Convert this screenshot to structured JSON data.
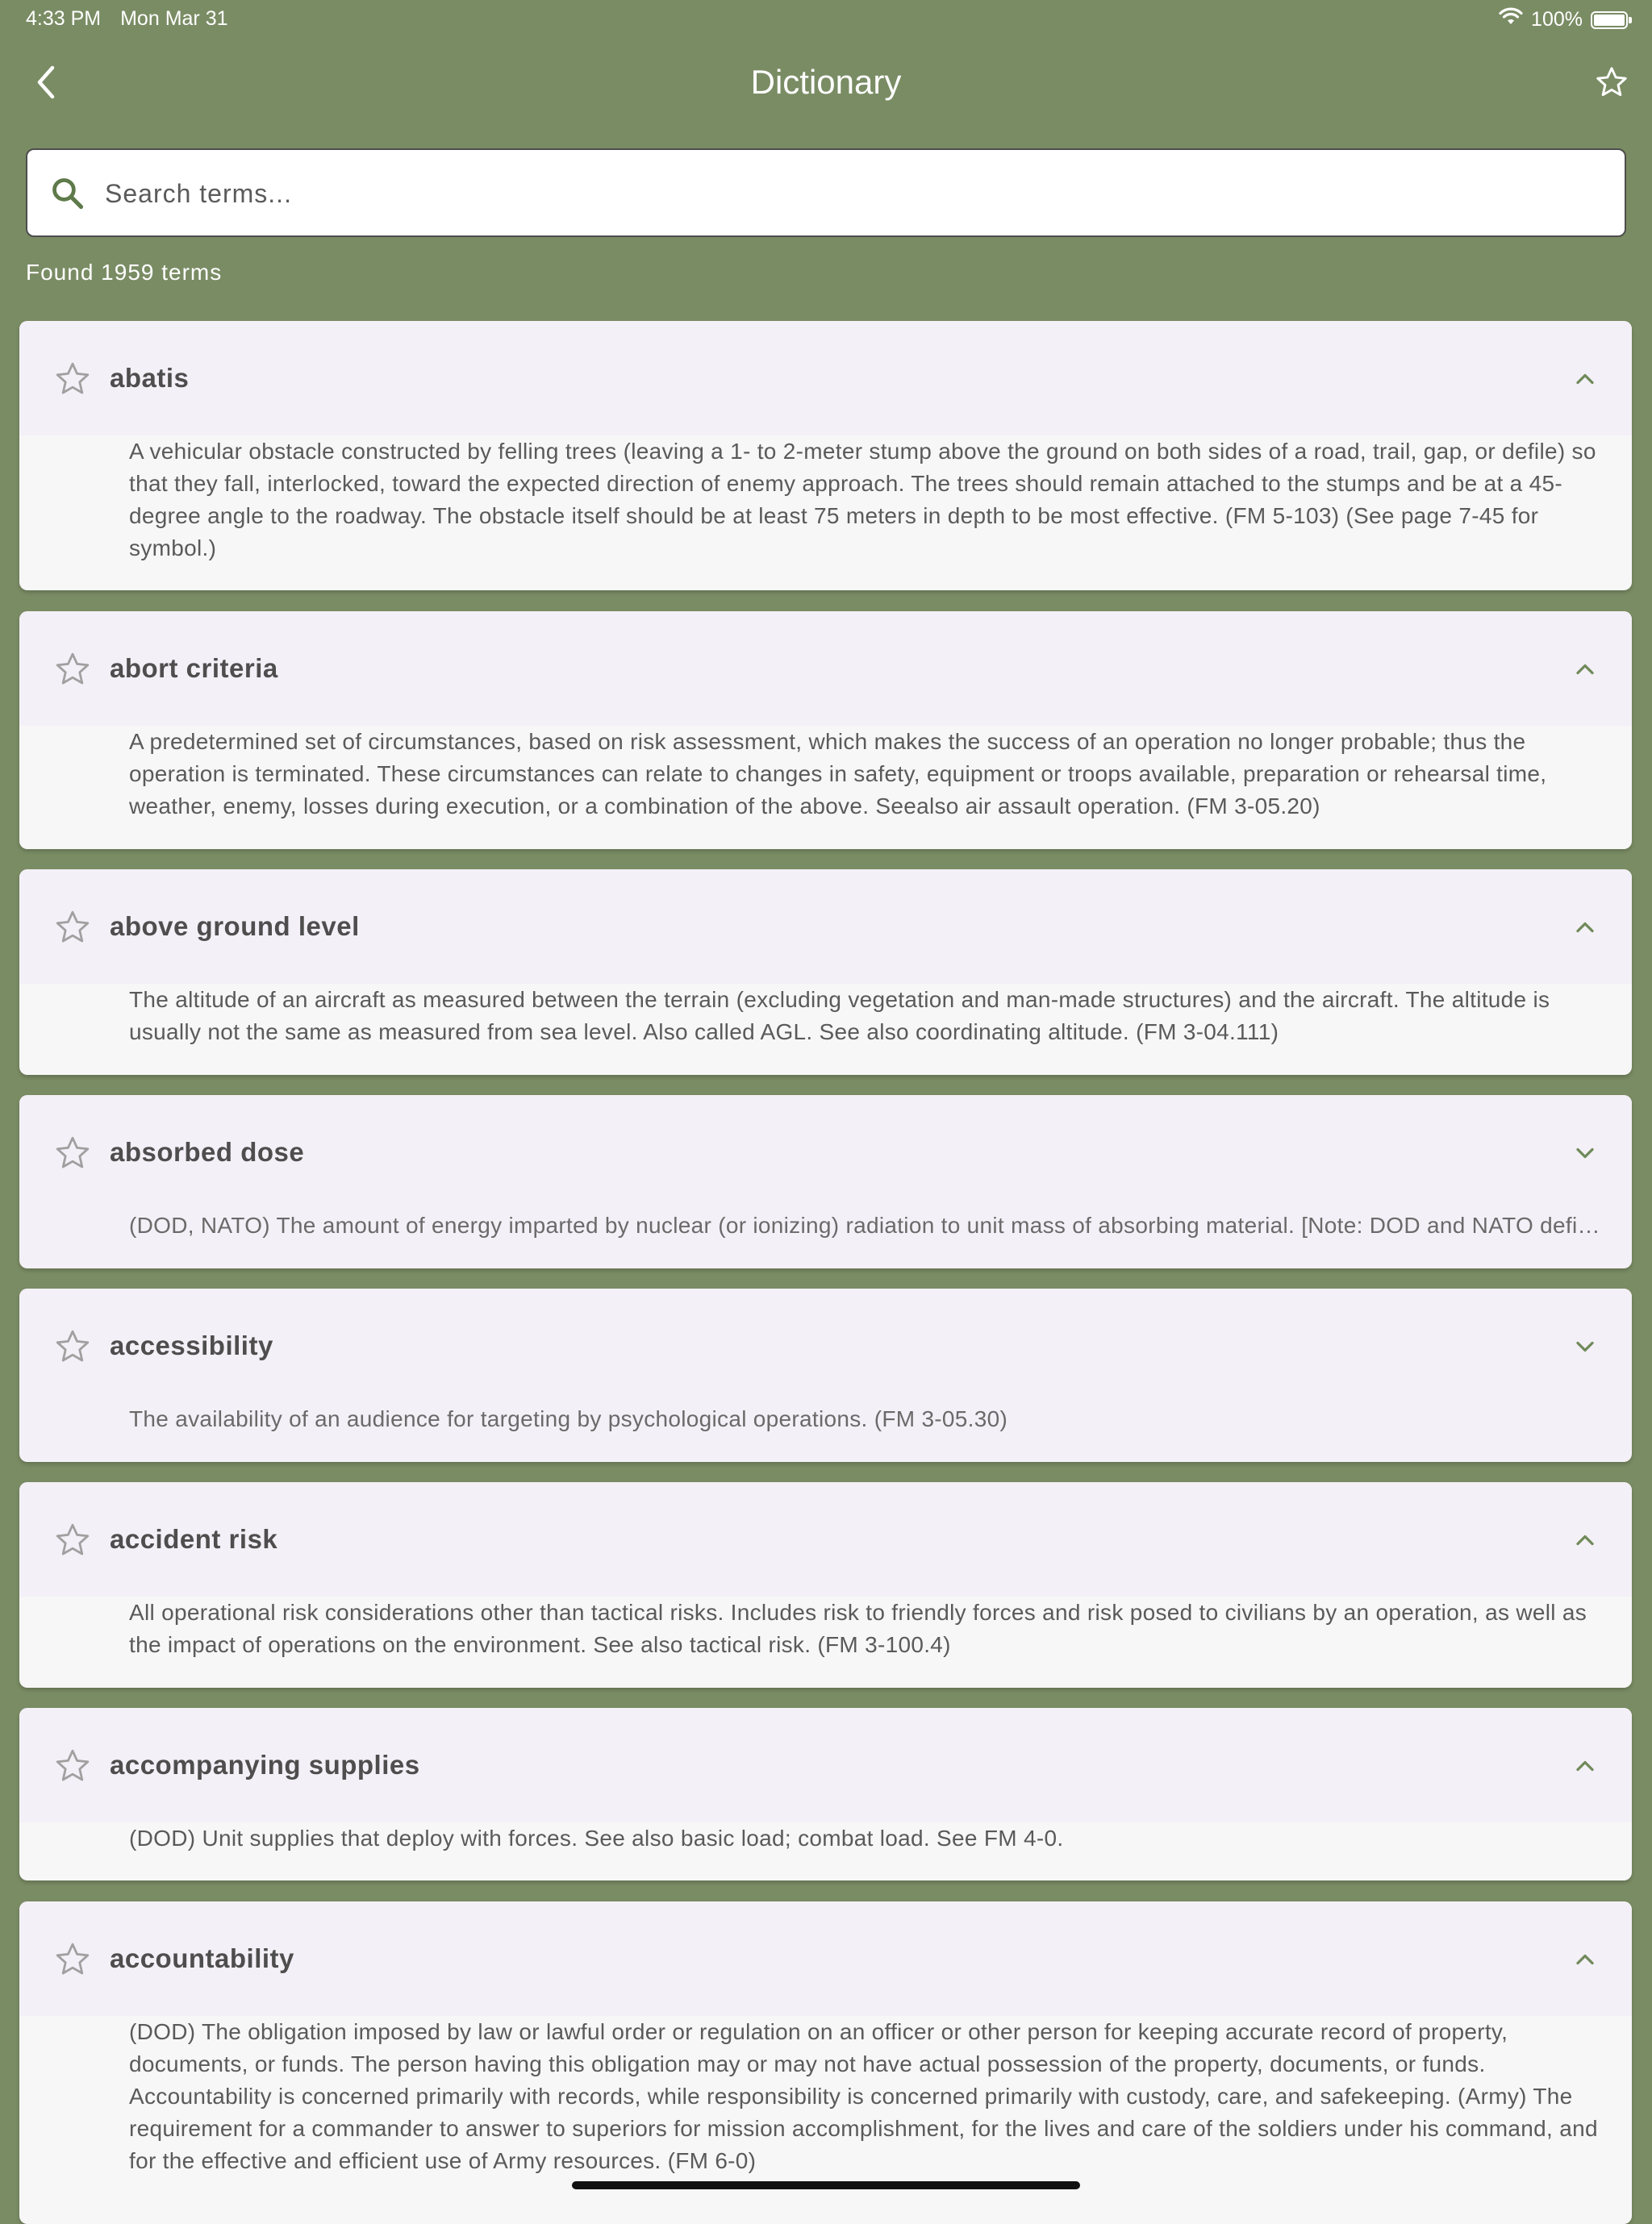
{
  "status_bar": {
    "time": "4:33 PM",
    "date": "Mon Mar 31",
    "battery_label": "100%",
    "battery_level": 1.0
  },
  "nav": {
    "title": "Dictionary",
    "back_icon": "chevron-left-icon",
    "favorite_icon": "star-outline-icon"
  },
  "search": {
    "placeholder": "Search terms...",
    "value": ""
  },
  "found_text": "Found 1959 terms",
  "colors": {
    "background": "#7a8c64",
    "card_header": "#f4f0f7",
    "card_body": "#f7f7f7",
    "accent": "#6f8a5a"
  },
  "terms": [
    {
      "term": "abatis",
      "expanded": true,
      "definition": "A vehicular obstacle constructed by felling trees (leaving a 1- to 2-meter stump above the ground on both sides of a road, trail, gap, or defile) so that they fall, interlocked, toward the expected direction of enemy approach. The trees should remain attached to the stumps  and be at a 45-degree angle to the roadway. The obstacle itself should be at least 75 meters  in depth to be most effective. (FM 5-103) (See page 7-45 for symbol.)"
    },
    {
      "term": "abort criteria",
      "expanded": true,
      "definition": "A predetermined set of circumstances, based on risk assessment, which makes  the success of an operation no longer probable; thus the operation is terminated. These  circumstances can relate to changes in safety, equipment or troops available, preparation or rehearsal time, weather, enemy, losses during execution, or a combination of the above. Seealso air assault operation. (FM 3-05.20)"
    },
    {
      "term": "above ground level",
      "expanded": true,
      "definition": "The altitude of an aircraft as measured between the terrain (excluding vegetation and man-made structures) and the aircraft. The altitude is usually not the same as measured from sea level. Also called AGL. See also coordinating altitude.  (FM 3-04.111)"
    },
    {
      "term": "absorbed dose",
      "expanded": false,
      "definition": "(DOD, NATO) The amount of energy imparted by nuclear (or ionizing) radiation to unit mass of absorbing material. [Note: DOD and NATO definitions differ slightly.]"
    },
    {
      "term": "accessibility",
      "expanded": false,
      "definition": "The availability of an audience for targeting by psychological operations.  (FM 3-05.30)"
    },
    {
      "term": "accident risk",
      "expanded": true,
      "definition": "All operational risk considerations other than tactical risks. Includes risk to  friendly forces and risk posed to civilians by an operation, as well as the impact of operations on the environment. See also tactical risk. (FM 3-100.4)"
    },
    {
      "term": "accompanying supplies",
      "expanded": true,
      "definition": "(DOD) Unit supplies that deploy with forces. See also basic load;  combat load. See FM 4-0."
    },
    {
      "term": "accountability",
      "expanded": true,
      "definition": "(DOD) The obligation imposed by law or lawful order or regulation on an  officer or other person for keeping accurate record of property, documents, or funds. The  person having this obligation may or may not have actual possession of the property, documents, or funds. Accountability is concerned primarily with records, while responsibility is concerned primarily with custody, care, and safekeeping. (Army) The requirement for a commander to answer to superiors for mission accomplishment, for the lives and care of the  soldiers under his command, and for the effective and efficient use of Army resources. (FM 6-0)"
    }
  ]
}
